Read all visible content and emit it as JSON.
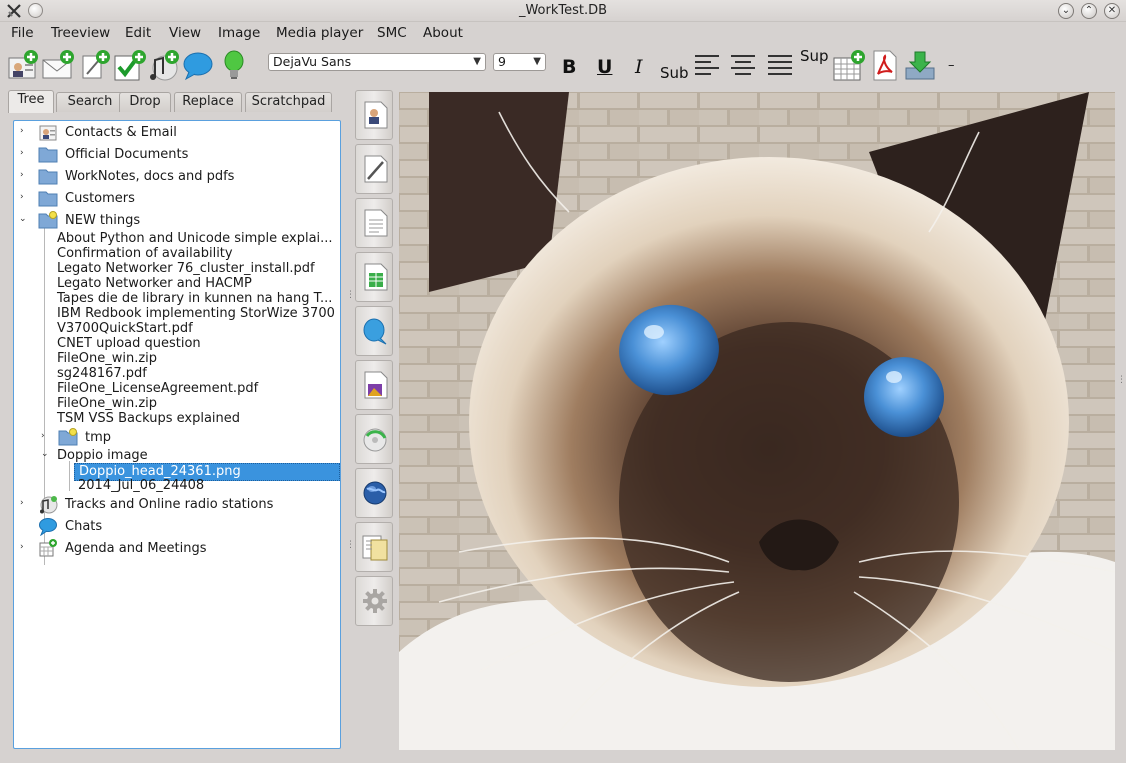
{
  "window": {
    "title": "_WorkTest.DB"
  },
  "menu": [
    "File",
    "Treeview",
    "Edit",
    "View",
    "Image",
    "Media player",
    "SMC",
    "About"
  ],
  "toolbar": {
    "icons": [
      "add-contact-icon",
      "add-email-icon",
      "add-note-icon",
      "add-task-icon",
      "add-music-icon",
      "chat-bubble-icon",
      "lightbulb-icon"
    ],
    "font_family": "DejaVu Sans",
    "font_size": "9",
    "bold": "B",
    "underline": "U",
    "italic": "I",
    "subscript": "Sub",
    "superscript": "Sup",
    "trailing": "–"
  },
  "tabs": [
    "Tree",
    "Search",
    "Drop",
    "Replace",
    "Scratchpad"
  ],
  "tree": {
    "top": [
      "Contacts & Email",
      "Official Documents",
      "WorkNotes, docs and pdfs",
      "Customers",
      "NEW things"
    ],
    "new_children": [
      "About Python and Unicode simple explai...",
      "Confirmation of availability",
      "Legato Networker 76_cluster_install.pdf",
      "Legato Networker and HACMP",
      "Tapes die de library in kunnen na hang T...",
      "IBM Redbook implementing StorWize 3700",
      "V3700QuickStart.pdf",
      "CNET upload question",
      "FileOne_win.zip",
      "sg248167.pdf",
      "FileOne_LicenseAgreement.pdf",
      "FileOne_win.zip",
      "TSM VSS Backups explained"
    ],
    "tmp": "tmp",
    "doppio": "Doppio image",
    "doppio_children": [
      "Doppio_head_24361.png",
      "2014_Jul_06_24408"
    ],
    "bottom": [
      "Tracks and Online radio stations",
      "Chats",
      "Agenda and Meetings"
    ]
  },
  "side_buttons": [
    "contact-card-icon",
    "edit-note-icon",
    "document-icon",
    "spreadsheet-icon",
    "chat-icon",
    "image-file-icon",
    "disc-icon",
    "globe-icon",
    "folder-files-icon",
    "settings-gear-icon"
  ],
  "colors": {
    "selection": "#3a93de",
    "tree_border": "#5aa0de",
    "folder": "#7fa8d6"
  }
}
